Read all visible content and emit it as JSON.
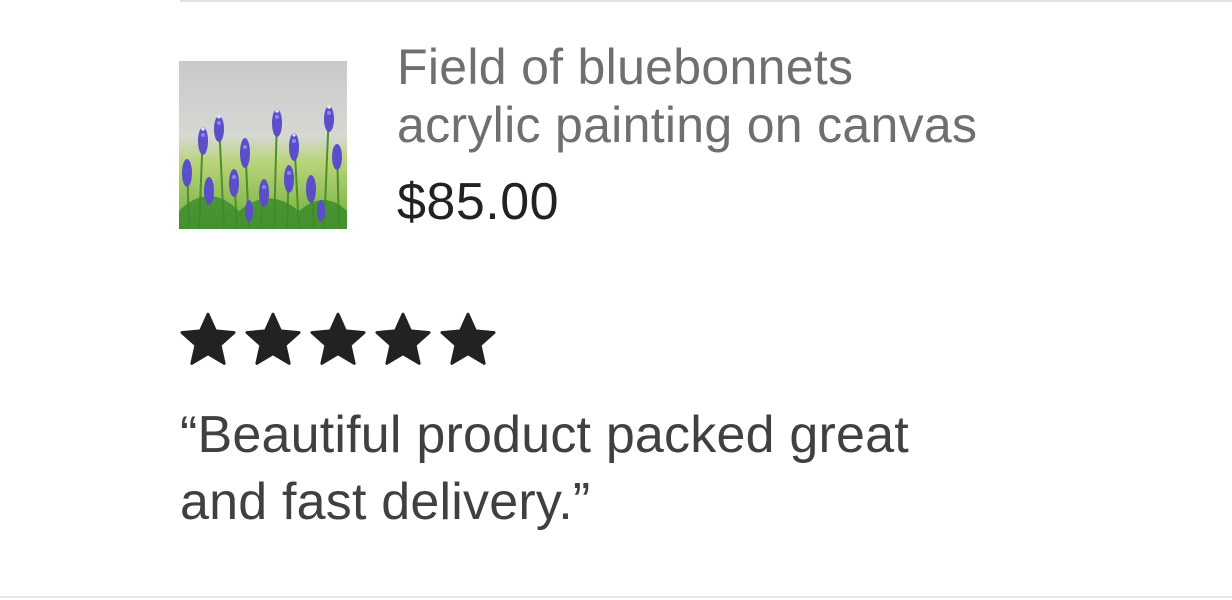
{
  "listing": {
    "title_line1": "Field of bluebonnets",
    "title_line2": "acrylic painting on canvas",
    "price": "$85.00",
    "thumbnail_icon": "bluebonnet-painting-thumbnail"
  },
  "review": {
    "rating": 5,
    "rating_max": 5,
    "star_color": "#222222",
    "text_line1": "“Beautiful product packed great",
    "text_line2": "and fast delivery.”"
  },
  "colors": {
    "title": "#6f6f6f",
    "price": "#222222",
    "review_text": "#404040",
    "divider": "#e1e1e1"
  }
}
